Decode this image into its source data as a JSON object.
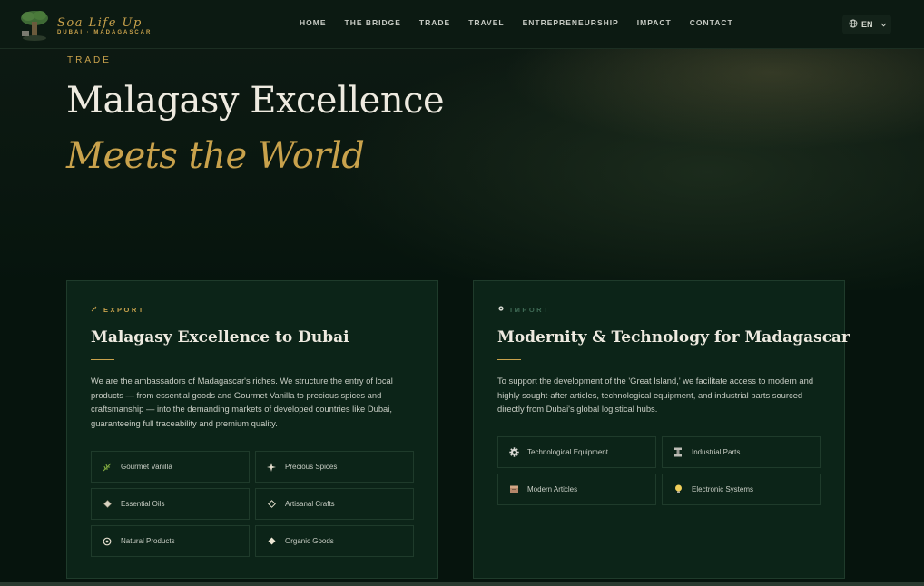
{
  "brand": {
    "title": "Soa Life Up",
    "subtitle": "DUBAI · MADAGASCAR"
  },
  "nav": {
    "items": [
      "HOME",
      "THE BRIDGE",
      "TRADE",
      "TRAVEL",
      "ENTREPRENEURSHIP",
      "IMPACT",
      "CONTACT"
    ],
    "language": "EN"
  },
  "hero": {
    "eyebrow": "TRADE",
    "title_line1": "Malagasy Excellence",
    "title_line2": "Meets the World"
  },
  "export": {
    "tag": "EXPORT",
    "title": "Malagasy Excellence to Dubai",
    "body": "We are the ambassadors of Madagascar's riches. We structure the entry of local products — from essential goods and Gourmet Vanilla to precious spices and craftsmanship — into the demanding markets of developed countries like Dubai, guaranteeing full traceability and premium quality.",
    "items": [
      {
        "label": "Gourmet Vanilla",
        "icon": "vanilla-leaf-icon"
      },
      {
        "label": "Precious Spices",
        "icon": "sparkle-icon"
      },
      {
        "label": "Essential Oils",
        "icon": "diamond-icon"
      },
      {
        "label": "Artisanal Crafts",
        "icon": "diamond-outline-icon"
      },
      {
        "label": "Natural Products",
        "icon": "circle-icon"
      },
      {
        "label": "Organic Goods",
        "icon": "diamond-icon"
      }
    ]
  },
  "import": {
    "tag": "IMPORT",
    "title": "Modernity & Technology for Madagascar",
    "body": "To support the development of the 'Great Island,' we facilitate access to modern and highly sought-after articles, technological equipment, and industrial parts sourced directly from Dubai's global logistical hubs.",
    "items": [
      {
        "label": "Technological Equipment",
        "icon": "gear-icon"
      },
      {
        "label": "Industrial Parts",
        "icon": "bolt-part-icon"
      },
      {
        "label": "Modern Articles",
        "icon": "box-icon"
      },
      {
        "label": "Electronic Systems",
        "icon": "lightbulb-icon"
      }
    ]
  },
  "colors": {
    "accent": "#c9a24c",
    "card_bg": "#0c2418",
    "page_bg": "#06140d"
  }
}
